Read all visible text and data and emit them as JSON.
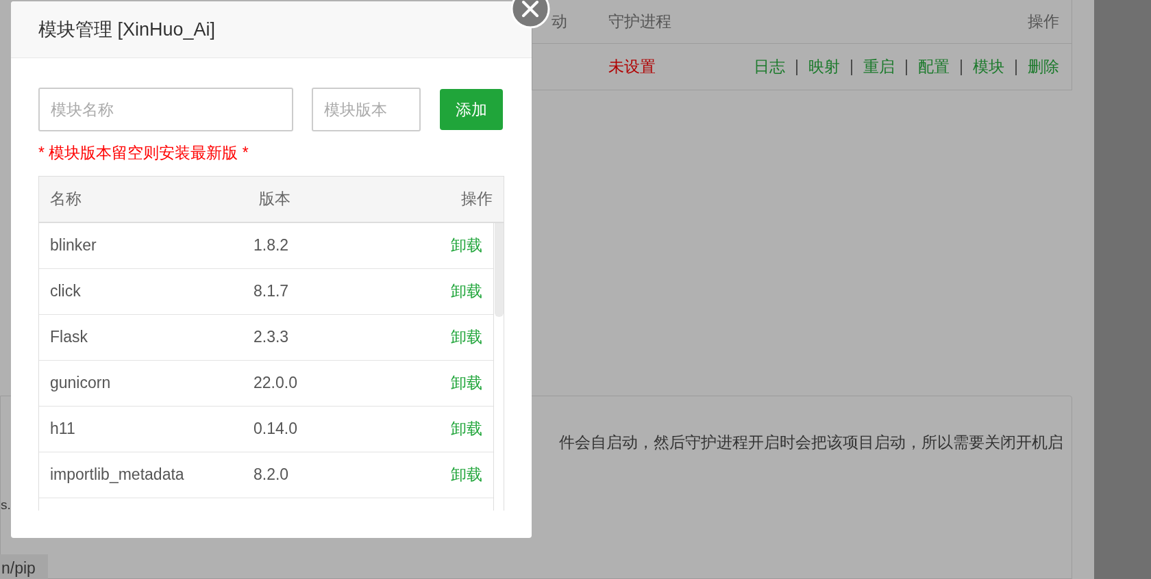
{
  "background_page": {
    "table": {
      "columns": [
        "动",
        "守护进程",
        "操作"
      ],
      "rows": [
        {
          "daemon": "未设置",
          "actions": [
            "日志",
            "映射",
            "重启",
            "配置",
            "模块",
            "删除"
          ],
          "separator": "|"
        }
      ]
    },
    "note_fragments": [
      "件会自启动，然后守护进程开启时会把该项目启动，所以需要关闭开机启",
      "s.",
      "n/pip"
    ]
  },
  "dialog": {
    "title": "模块管理 [XinHuo_Ai]",
    "name_field": {
      "placeholder": "模块名称"
    },
    "version_field": {
      "placeholder": "模块版本"
    },
    "add_button": "添加",
    "hint": "* 模块版本留空则安装最新版 *",
    "table": {
      "columns": [
        "名称",
        "版本",
        "操作"
      ],
      "rows": [
        {
          "name": "blinker",
          "version": "1.8.2",
          "action": "卸载"
        },
        {
          "name": "click",
          "version": "8.1.7",
          "action": "卸载"
        },
        {
          "name": "Flask",
          "version": "2.3.3",
          "action": "卸载"
        },
        {
          "name": "gunicorn",
          "version": "22.0.0",
          "action": "卸载"
        },
        {
          "name": "h11",
          "version": "0.14.0",
          "action": "卸载"
        },
        {
          "name": "importlib_metadata",
          "version": "8.2.0",
          "action": "卸载"
        }
      ]
    }
  }
}
